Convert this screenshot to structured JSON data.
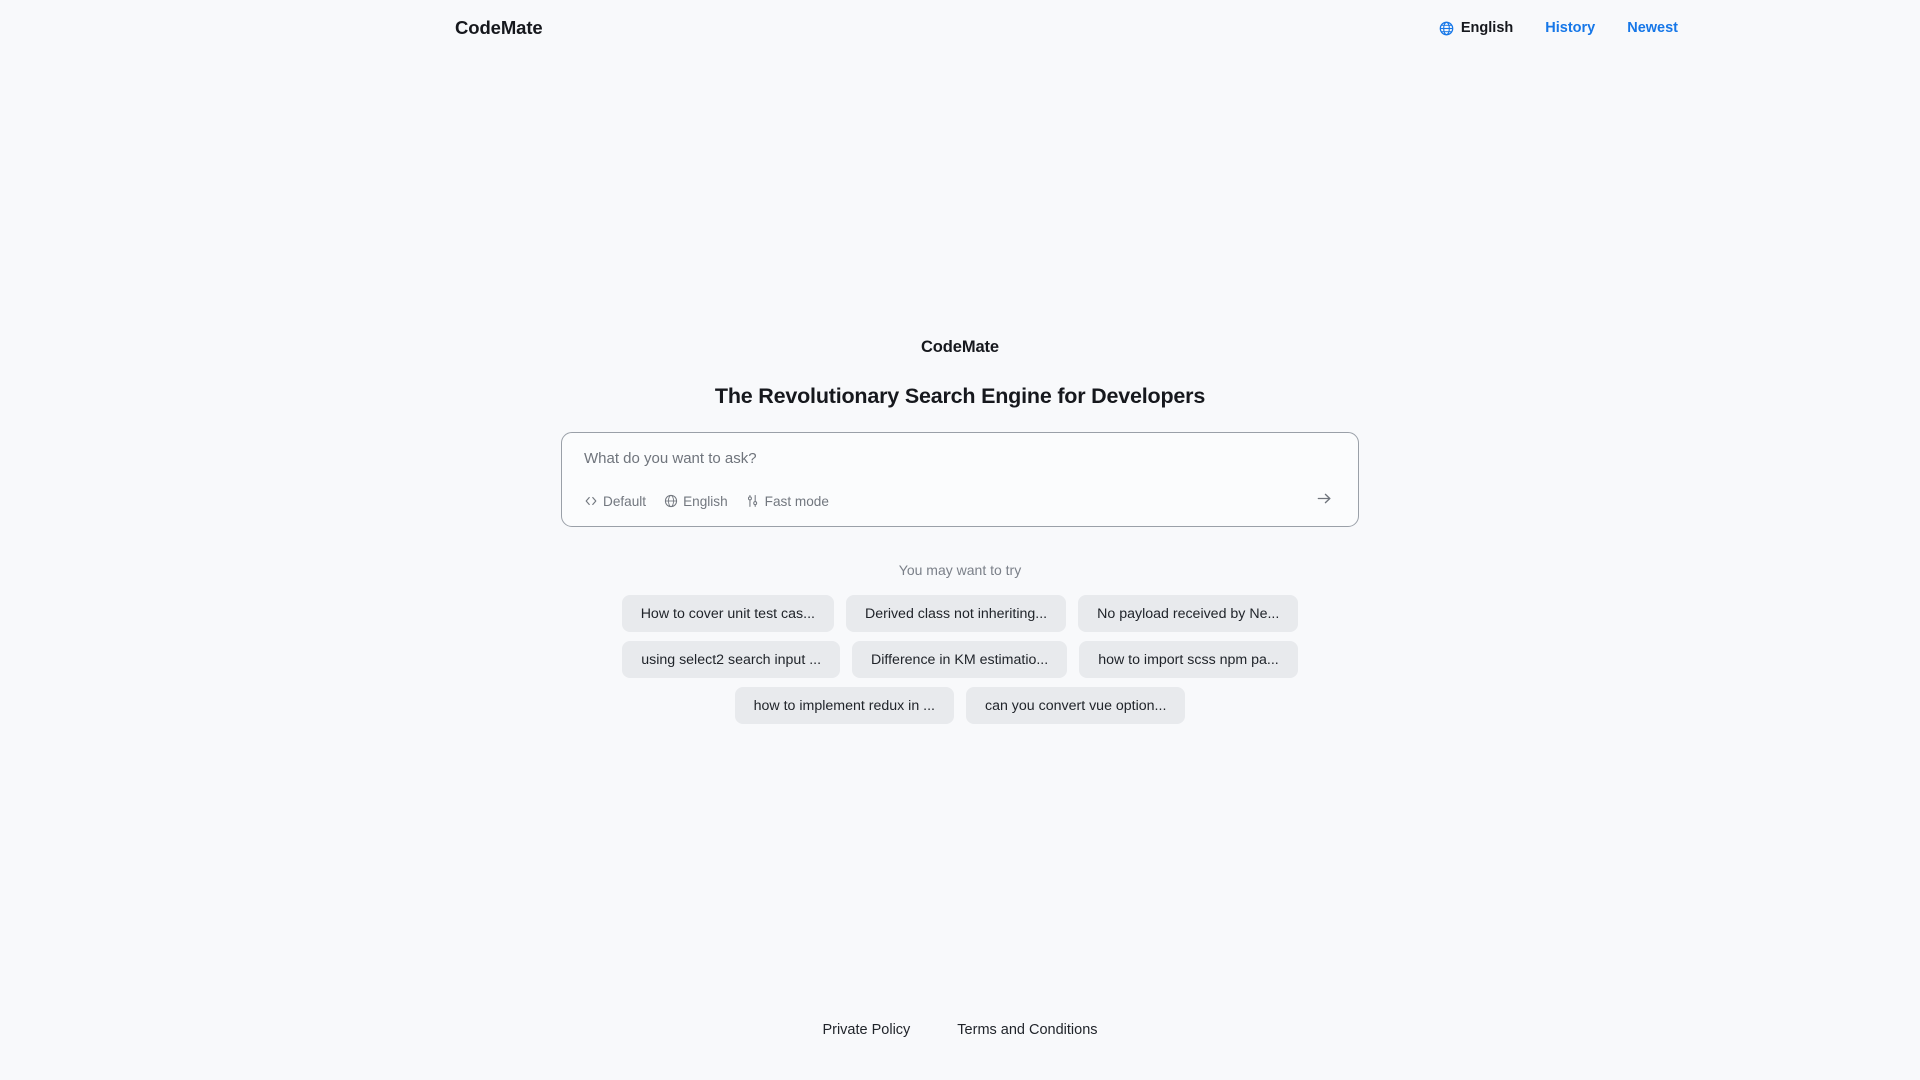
{
  "header": {
    "brand": "CodeMate",
    "language": {
      "label": "English",
      "icon": "globe-icon"
    },
    "links": [
      {
        "label": "History"
      },
      {
        "label": "Newest"
      }
    ],
    "link_color": "#1677e8"
  },
  "hero": {
    "brand": "CodeMate",
    "title": "The Revolutionary Search Engine for Developers"
  },
  "search": {
    "placeholder": "What do you want to ask?",
    "value": "",
    "tools": [
      {
        "label": "Default",
        "icon": "code-brackets-icon"
      },
      {
        "label": "English",
        "icon": "globe-icon"
      },
      {
        "label": "Fast mode",
        "icon": "sliders-icon"
      }
    ],
    "submit_icon": "arrow-right-icon"
  },
  "suggestions": {
    "label": "You may want to try",
    "rows": [
      [
        {
          "label": "How to cover unit test cas..."
        },
        {
          "label": "Derived class not inheriting..."
        },
        {
          "label": "No payload received by Ne..."
        }
      ],
      [
        {
          "label": "using select2 search input ..."
        },
        {
          "label": "Difference in KM estimatio..."
        },
        {
          "label": "how to import scss npm pa..."
        }
      ],
      [
        {
          "label": "how to implement redux in ..."
        },
        {
          "label": "can you convert vue option..."
        }
      ]
    ]
  },
  "footer": {
    "links": [
      {
        "label": "Private Policy"
      },
      {
        "label": "Terms and Conditions"
      }
    ]
  }
}
